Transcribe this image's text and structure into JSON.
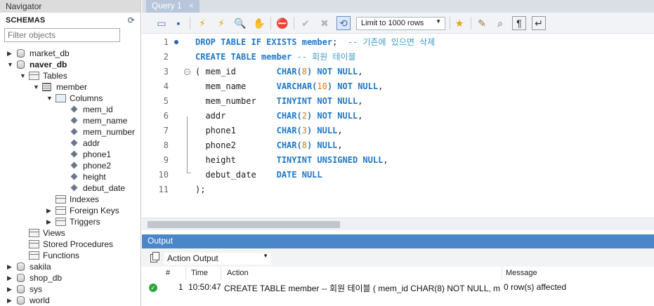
{
  "navigator": {
    "title": "Navigator",
    "schemas_label": "SCHEMAS",
    "filter_placeholder": "Filter objects",
    "tree": [
      {
        "label": "market_db"
      },
      {
        "label": "naver_db"
      },
      {
        "label": "Tables"
      },
      {
        "label": "member"
      },
      {
        "label": "Columns"
      },
      {
        "label": "mem_id"
      },
      {
        "label": "mem_name"
      },
      {
        "label": "mem_number"
      },
      {
        "label": "addr"
      },
      {
        "label": "phone1"
      },
      {
        "label": "phone2"
      },
      {
        "label": "height"
      },
      {
        "label": "debut_date"
      },
      {
        "label": "Indexes"
      },
      {
        "label": "Foreign Keys"
      },
      {
        "label": "Triggers"
      },
      {
        "label": "Views"
      },
      {
        "label": "Stored Procedures"
      },
      {
        "label": "Functions"
      },
      {
        "label": "sakila"
      },
      {
        "label": "shop_db"
      },
      {
        "label": "sys"
      },
      {
        "label": "world"
      }
    ]
  },
  "tab": {
    "label": "Query 1",
    "close": "×"
  },
  "toolbar": {
    "limit_label": "Limit to 1000 rows"
  },
  "editor": {
    "line_numbers": [
      "1",
      "2",
      "3",
      "4",
      "5",
      "6",
      "7",
      "8",
      "9",
      "10",
      "11"
    ],
    "lines": [
      [
        {
          "t": "kw",
          "v": "DROP TABLE IF EXISTS "
        },
        {
          "t": "kw",
          "v": "member"
        },
        {
          "t": "id",
          "v": ";  "
        },
        {
          "t": "cm",
          "v": "-- 기존에 있으면 삭제"
        }
      ],
      [
        {
          "t": "kw",
          "v": "CREATE TABLE "
        },
        {
          "t": "kw",
          "v": "member"
        },
        {
          "t": "cm",
          "v": " -- 회원 테이블"
        }
      ],
      [
        {
          "t": "id",
          "v": "( mem_id        "
        },
        {
          "t": "kw",
          "v": "CHAR("
        },
        {
          "t": "num",
          "v": "8"
        },
        {
          "t": "kw",
          "v": ") NOT NULL"
        },
        {
          "t": "id",
          "v": ","
        }
      ],
      [
        {
          "t": "id",
          "v": "  mem_name      "
        },
        {
          "t": "kw",
          "v": "VARCHAR("
        },
        {
          "t": "num",
          "v": "10"
        },
        {
          "t": "kw",
          "v": ") NOT NULL"
        },
        {
          "t": "id",
          "v": ","
        }
      ],
      [
        {
          "t": "id",
          "v": "  mem_number    "
        },
        {
          "t": "kw",
          "v": "TINYINT NOT NULL"
        },
        {
          "t": "id",
          "v": ","
        }
      ],
      [
        {
          "t": "id",
          "v": "  addr          "
        },
        {
          "t": "kw",
          "v": "CHAR("
        },
        {
          "t": "num",
          "v": "2"
        },
        {
          "t": "kw",
          "v": ") NOT NULL"
        },
        {
          "t": "id",
          "v": ","
        }
      ],
      [
        {
          "t": "id",
          "v": "  phone1        "
        },
        {
          "t": "kw",
          "v": "CHAR("
        },
        {
          "t": "num",
          "v": "3"
        },
        {
          "t": "kw",
          "v": ") NULL"
        },
        {
          "t": "id",
          "v": ","
        }
      ],
      [
        {
          "t": "id",
          "v": "  phone2        "
        },
        {
          "t": "kw",
          "v": "CHAR("
        },
        {
          "t": "num",
          "v": "8"
        },
        {
          "t": "kw",
          "v": ") NULL"
        },
        {
          "t": "id",
          "v": ","
        }
      ],
      [
        {
          "t": "id",
          "v": "  height        "
        },
        {
          "t": "kw",
          "v": "TINYINT UNSIGNED NULL"
        },
        {
          "t": "id",
          "v": ","
        }
      ],
      [
        {
          "t": "id",
          "v": "  debut_date    "
        },
        {
          "t": "kw",
          "v": "DATE NULL"
        }
      ],
      [
        {
          "t": "id",
          "v": ");"
        }
      ]
    ]
  },
  "output": {
    "title": "Output",
    "mode": "Action Output",
    "headers": {
      "num": "#",
      "time": "Time",
      "action": "Action",
      "message": "Message"
    },
    "rows": [
      {
        "num": "1",
        "time": "10:50:47",
        "action": "CREATE TABLE member -- 회원 테이블 ( mem_id        CHAR(8) NOT NULL,   m...",
        "message": "0 row(s) affected"
      }
    ]
  }
}
